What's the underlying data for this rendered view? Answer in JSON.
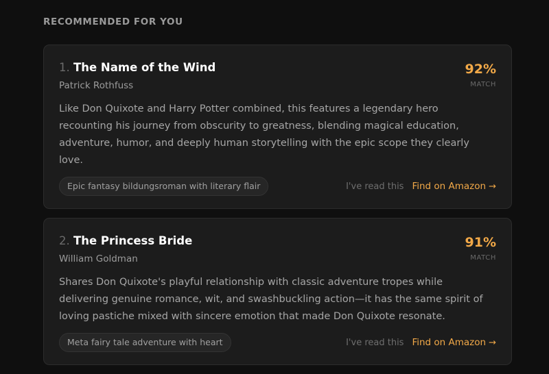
{
  "section": {
    "title": "RECOMMENDED FOR YOU"
  },
  "books": [
    {
      "rank": "1.",
      "title": "The Name of the Wind",
      "author": "Patrick Rothfuss",
      "match_pct": "92%",
      "match_label": "MATCH",
      "description": "Like Don Quixote and Harry Potter combined, this features a legendary hero recounting his journey from obscurity to greatness, blending magical education, adventure, humor, and deeply human storytelling with the epic scope they clearly love.",
      "tag": "Epic fantasy bildungsroman with literary flair",
      "read_label": "I've read this",
      "amazon_label": "Find on Amazon",
      "arrow": "→"
    },
    {
      "rank": "2.",
      "title": "The Princess Bride",
      "author": "William Goldman",
      "match_pct": "91%",
      "match_label": "MATCH",
      "description": "Shares Don Quixote's playful relationship with classic adventure tropes while delivering genuine romance, wit, and swashbuckling action—it has the same spirit of loving pastiche mixed with sincere emotion that made Don Quixote resonate.",
      "tag": "Meta fairy tale adventure with heart",
      "read_label": "I've read this",
      "amazon_label": "Find on Amazon",
      "arrow": "→"
    }
  ],
  "colors": {
    "accent": "#f2a948",
    "card_bg": "#1c1c1c",
    "page_bg": "#0f0f0f"
  },
  "icons": {
    "link_arrow": "arrow-right-icon"
  }
}
